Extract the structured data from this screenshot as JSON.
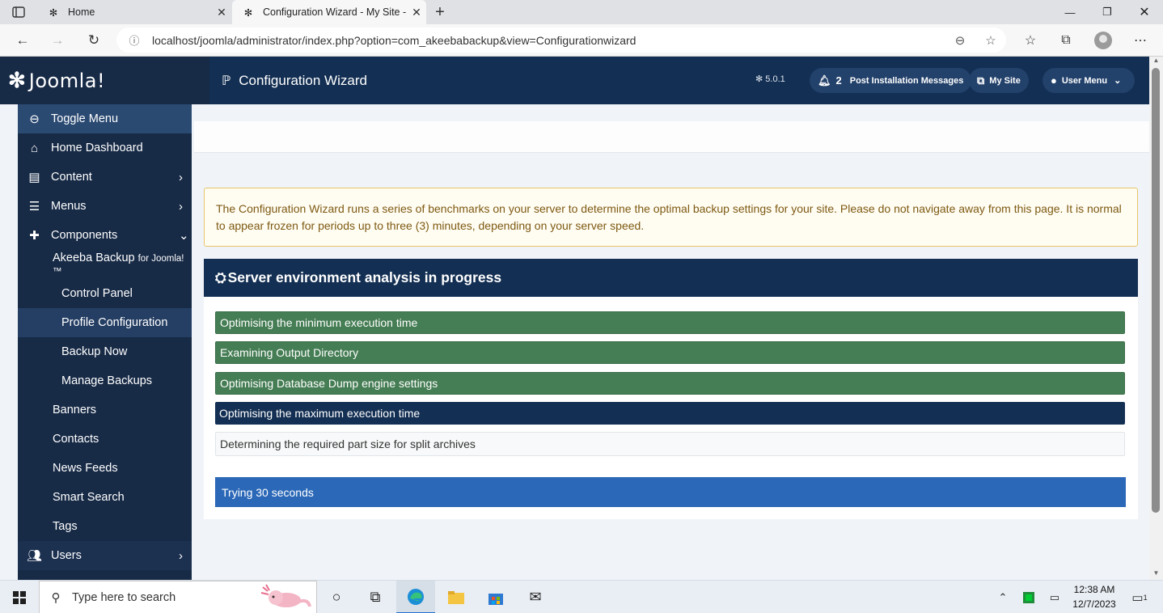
{
  "browser": {
    "tabs": [
      {
        "title": "Home",
        "active": false
      },
      {
        "title": "Configuration Wizard - My Site -",
        "active": true
      }
    ],
    "url": "localhost/joomla/administrator/index.php?option=com_akeebabackup&view=Configurationwizard"
  },
  "header": {
    "logo_text": "Joomla!",
    "page_title": "Configuration Wizard",
    "version": "5.0.1",
    "notification_count": "2",
    "post_install_label": "Post Installation Messages",
    "my_site_label": "My Site",
    "user_menu_label": "User Menu"
  },
  "sidebar": {
    "toggle": "Toggle Menu",
    "home": "Home Dashboard",
    "content": "Content",
    "menus": "Menus",
    "components": "Components",
    "akeeba_main": "Akeeba Backup",
    "akeeba_suffix": "for Joomla!™",
    "control_panel": "Control Panel",
    "profile_config": "Profile Configuration",
    "backup_now": "Backup Now",
    "manage_backups": "Manage Backups",
    "banners": "Banners",
    "contacts": "Contacts",
    "news_feeds": "News Feeds",
    "smart_search": "Smart Search",
    "tags": "Tags",
    "users": "Users"
  },
  "main": {
    "alert": "The Configuration Wizard runs a series of benchmarks on your server to determine the optimal backup settings for your site. Please do not navigate away from this page. It is normal to appear frozen for periods up to three (3) minutes, depending on your server speed.",
    "card_title": "Server environment analysis in progress",
    "steps": [
      {
        "label": "Optimising the minimum execution time",
        "status": "done"
      },
      {
        "label": "Examining Output Directory",
        "status": "done"
      },
      {
        "label": "Optimising Database Dump engine settings",
        "status": "done"
      },
      {
        "label": "Optimising the maximum execution time",
        "status": "active"
      },
      {
        "label": "Determining the required part size for split archives",
        "status": "pending"
      }
    ],
    "progress_text": "Trying 30 seconds"
  },
  "taskbar": {
    "search_placeholder": "Type here to search",
    "time": "12:38 AM",
    "date": "12/7/2023",
    "notification_badge": "1"
  },
  "colors": {
    "header_bg": "#132f53",
    "sidebar_bg": "#172a46",
    "step_done": "#457d54",
    "step_active": "#132f53",
    "progress": "#2b68b7",
    "alert_text": "#7d5a12"
  }
}
